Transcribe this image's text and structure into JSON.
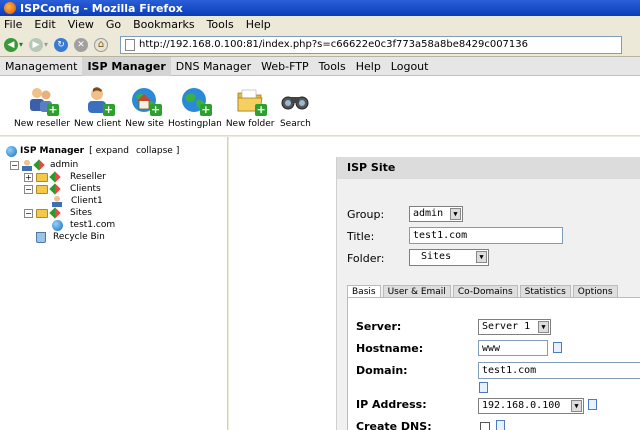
{
  "window": {
    "title": "ISPConfig - Mozilla Firefox"
  },
  "browser_menu": [
    "File",
    "Edit",
    "View",
    "Go",
    "Bookmarks",
    "Tools",
    "Help"
  ],
  "address": {
    "url": "http://192.168.0.100:81/index.php?s=c66622e0c3f773a58a8be8429c007136"
  },
  "app_menu": {
    "items": [
      "Management",
      "ISP Manager",
      "DNS Manager",
      "Web-FTP",
      "Tools",
      "Help",
      "Logout"
    ],
    "active": "ISP Manager"
  },
  "toolbar": {
    "items": [
      {
        "label": "New reseller",
        "icon": "users-add-icon"
      },
      {
        "label": "New client",
        "icon": "user-add-icon"
      },
      {
        "label": "New site",
        "icon": "globe-house-add-icon"
      },
      {
        "label": "Hostingplan",
        "icon": "globe-add-icon"
      },
      {
        "label": "New folder",
        "icon": "folder-add-icon"
      },
      {
        "label": "Search",
        "icon": "binoculars-icon"
      }
    ]
  },
  "tree": {
    "header": "ISP Manager",
    "expand": "expand",
    "collapse": "collapse",
    "bracket_open": "[",
    "bracket_close": "]",
    "nodes": [
      {
        "label": "admin"
      },
      {
        "label": "Reseller"
      },
      {
        "label": "Clients"
      },
      {
        "label": "Client1"
      },
      {
        "label": "Sites"
      },
      {
        "label": "test1.com"
      },
      {
        "label": "Recycle Bin"
      }
    ]
  },
  "panel": {
    "title": "ISP Site",
    "group_label": "Group:",
    "group_value": "admin",
    "title_label": "Title:",
    "title_value": "test1.com",
    "folder_label": "Folder:",
    "folder_value": "Sites",
    "tabs": [
      "Basis",
      "User & Email",
      "Co-Domains",
      "Statistics",
      "Options"
    ],
    "active_tab": "Basis",
    "fields": {
      "server_label": "Server:",
      "server_value": "Server 1",
      "hostname_label": "Hostname:",
      "hostname_value": "www",
      "domain_label": "Domain:",
      "domain_value": "test1.com",
      "ip_label": "IP Address:",
      "ip_value": "192.168.0.100",
      "dns_label": "Create DNS:"
    }
  }
}
